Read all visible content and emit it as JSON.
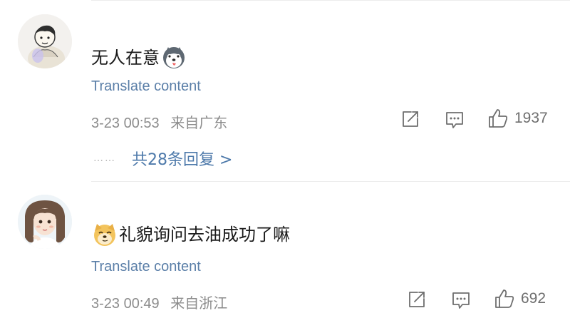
{
  "comments": [
    {
      "text": "无人在意",
      "emoji": "husky-face-emoji",
      "translate_label": "Translate content",
      "time": "3-23 00:53",
      "location": "来自广东",
      "like_count": "1937",
      "replies_label": "共28条回复 >",
      "dots": "……"
    },
    {
      "text": "礼貌询问去油成功了嘛",
      "emoji": "doge-face-emoji",
      "translate_label": "Translate content",
      "time": "3-23 00:49",
      "location": "来自浙江",
      "like_count": "692"
    }
  ],
  "icons": [
    "share-icon",
    "comment-icon",
    "like-icon"
  ],
  "colors": {
    "link": "#5b7fa8",
    "meta": "#8c8c8c",
    "text": "#1a1a1a"
  }
}
